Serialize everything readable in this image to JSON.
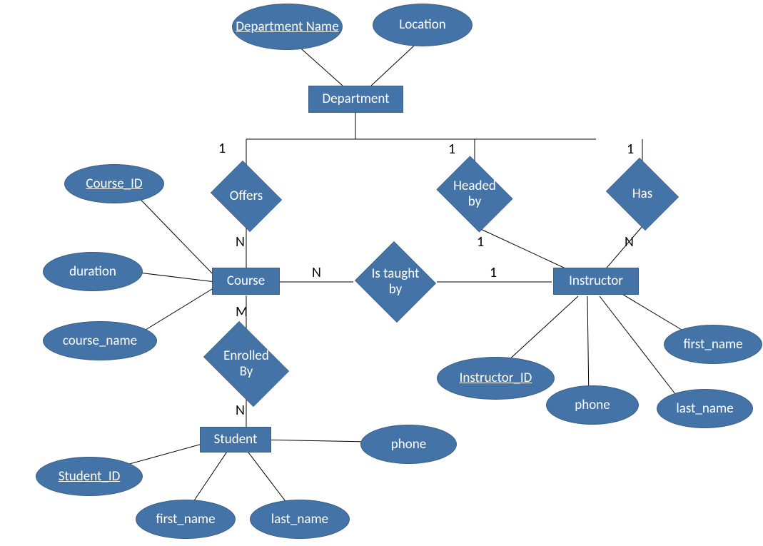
{
  "entities": {
    "department": "Department",
    "course": "Course",
    "instructor": "Instructor",
    "student": "Student"
  },
  "relationships": {
    "offers": "Offers",
    "headed_by": "Headed by",
    "has": "Has",
    "is_taught_by": "Is taught by",
    "enrolled_by": "Enrolled By"
  },
  "attributes": {
    "department_name": "Department Name",
    "location": "Location",
    "course_id": "Course_ID",
    "duration": "duration",
    "course_name": "course_name",
    "instructor_id": "Instructor_ID",
    "instructor_first_name": "first_name",
    "instructor_last_name": "last_name",
    "instructor_phone": "phone",
    "student_id": "Student_ID",
    "student_first_name": "first_name",
    "student_last_name": "last_name",
    "student_phone": "phone"
  },
  "cardinalities": {
    "dept_offers": "1",
    "offers_course": "N",
    "dept_headed": "1",
    "headed_instr": "1",
    "dept_has": "1",
    "has_instr": "N",
    "course_taught": "N",
    "taught_instr": "1",
    "course_enrolled": "M",
    "enrolled_student": "N"
  }
}
